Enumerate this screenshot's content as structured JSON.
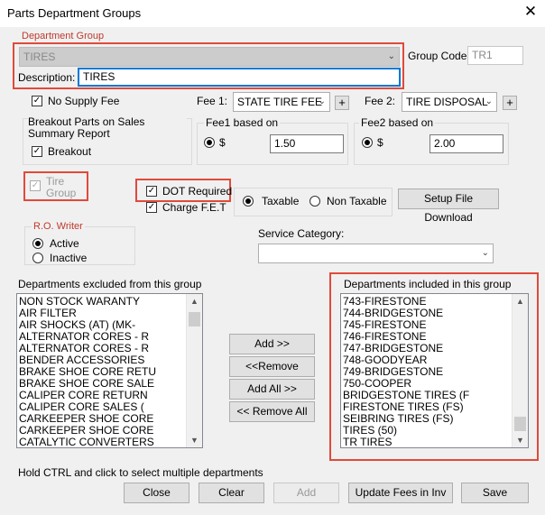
{
  "window": {
    "title": "Parts Department Groups",
    "close_glyph": "✕"
  },
  "department_group": {
    "legend": "Department Group",
    "selected_group": "TIRES",
    "group_code_label": "Group Code:",
    "group_code_value": "TR1",
    "description_label": "Description:",
    "description_value": "TIRES"
  },
  "no_supply_fee": {
    "label": "No Supply Fee",
    "checked": true
  },
  "fee1": {
    "label": "Fee 1:",
    "value": "STATE TIRE FEE",
    "add": "+",
    "based_on_label": "Fee1 based on",
    "radio_label": "$",
    "amount": "1.50"
  },
  "fee2": {
    "label": "Fee 2:",
    "value": "TIRE DISPOSAL",
    "add": "+",
    "based_on_label": "Fee2 based on",
    "radio_label": "$",
    "amount": "2.00"
  },
  "breakout": {
    "legend": "Breakout Parts on Sales Summary Report",
    "checkbox_label": "Breakout",
    "checked": true
  },
  "tire_group": {
    "label": "Tire Group",
    "checked": true,
    "enabled": false
  },
  "dot_required": {
    "label": "DOT Required",
    "checked": true
  },
  "charge_fet": {
    "label": "Charge F.E.T",
    "checked": true
  },
  "taxable": {
    "taxable_label": "Taxable",
    "non_taxable_label": "Non Taxable",
    "selected": "taxable"
  },
  "setup_file_download": "Setup File Download",
  "ro_writer": {
    "legend": "R.O. Writer",
    "active_label": "Active",
    "inactive_label": "Inactive",
    "selected": "active"
  },
  "service_category": {
    "label": "Service Category:",
    "value": ""
  },
  "excluded": {
    "label": "Departments excluded from this group",
    "items": [
      " NON STOCK WARANTY",
      "AIR FILTER",
      "AIR SHOCKS (AT) (MK-",
      "ALTERNATOR CORES - R",
      "ALTERNATOR CORES - R",
      "BENDER ACCESSORIES",
      "BRAKE SHOE CORE RETU",
      "BRAKE SHOE CORE SALE",
      "CALIPER CORE RETURN",
      "CALIPER CORE SALES (",
      "CARKEEPER SHOE CORE",
      "CARKEEPER SHOE CORE",
      "CATALYTIC CONVERTERS"
    ]
  },
  "included": {
    "label": "Departments included in this group",
    "items": [
      "743-FIRESTONE",
      "744-BRIDGESTONE",
      "745-FIRESTONE",
      "746-FIRESTONE",
      "747-BRIDGESTONE",
      "748-GOODYEAR",
      "749-BRIDGESTONE",
      "750-COOPER",
      "BRIDGESTONE TIRES (F",
      "FIRESTONE TIRES (FS)",
      "SEIBRING TIRES (FS)",
      "TIRES (50)",
      "TR TIRES"
    ]
  },
  "move_buttons": {
    "add": "Add >>",
    "remove": "<<Remove",
    "add_all": "Add All >>",
    "remove_all": "<< Remove All"
  },
  "hint": "Hold CTRL and click to select multiple departments",
  "footer": {
    "close": "Close",
    "clear": "Clear",
    "add": "Add",
    "update_fees": "Update Fees in Inv",
    "save": "Save"
  },
  "colors": {
    "highlight": "#e04a3b",
    "legend_red": "#c0392b",
    "window_bg": "#f0f0f0"
  }
}
